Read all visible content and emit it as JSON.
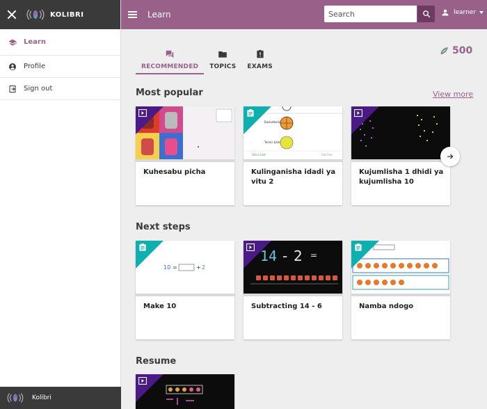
{
  "app": {
    "brand": "KOLIBRI",
    "page_title": "Learn",
    "footer_brand": "Kolibri"
  },
  "sidenav": {
    "items": [
      {
        "label": "Learn",
        "icon": "learn-icon",
        "active": true
      },
      {
        "label": "Profile",
        "icon": "profile-icon"
      },
      {
        "label": "Sign out",
        "icon": "sign-out-icon"
      }
    ]
  },
  "search": {
    "placeholder": "Search",
    "value": ""
  },
  "user": {
    "name": "learner"
  },
  "tabs": [
    {
      "label": "RECOMMENDED",
      "icon": "recommended-icon",
      "active": true
    },
    {
      "label": "TOPICS",
      "icon": "folder-icon"
    },
    {
      "label": "EXAMS",
      "icon": "exam-icon"
    }
  ],
  "points": {
    "value": "500",
    "icon": "points-icon"
  },
  "sections": {
    "popular": {
      "title": "Most popular",
      "view_more": "View more",
      "cards": [
        {
          "title": "Kuhesabu picha",
          "kind": "video"
        },
        {
          "title": "Kulinganisha idadi ya vitu 2",
          "kind": "exercise"
        },
        {
          "title": "Kujumlisha 1 dhidi ya kujumlisha 10",
          "kind": "video"
        }
      ]
    },
    "next": {
      "title": "Next steps",
      "cards": [
        {
          "title": "Make 10",
          "kind": "exercise"
        },
        {
          "title": "Subtracting 14 - 6",
          "kind": "video"
        },
        {
          "title": "Namba ndogo",
          "kind": "exercise"
        }
      ]
    },
    "resume": {
      "title": "Resume",
      "cards": [
        {
          "title": "",
          "kind": "video"
        }
      ]
    }
  },
  "thumbnails": {
    "ball_labels": [
      "Basketballs",
      "Tennis balls"
    ],
    "get_hint": "Get a hint",
    "get_line": "Get line",
    "equation": {
      "left": "10",
      "eq": "=",
      "plus": "+",
      "right": "2"
    },
    "chalk": {
      "left": "14",
      "minus": "-",
      "right": "2",
      "eq": "="
    }
  },
  "colors": {
    "brand": "#996189",
    "appbar": "#996189",
    "video_badge": "#4a1b86",
    "exercise_badge": "#0eafaf"
  }
}
